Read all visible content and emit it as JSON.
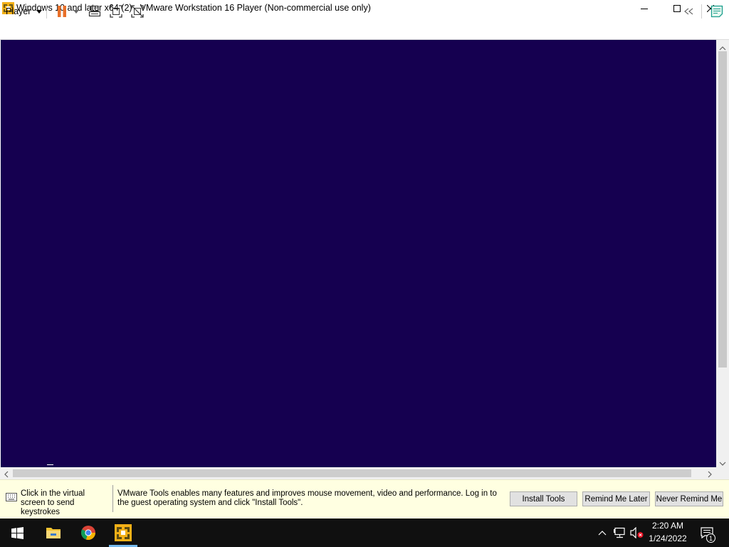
{
  "window": {
    "title": "Windows 10 and later x64 (2) - VMware Workstation 16 Player (Non-commercial use only)",
    "controls": [
      "minimize-icon",
      "maximize-icon",
      "close-icon"
    ]
  },
  "toolbar": {
    "player_menu": "Player",
    "icons": [
      "pause-icon",
      "dropdown-icon",
      "send-ctrl-alt-del-icon",
      "full-screen-icon",
      "unity-icon",
      "collapse-icon",
      "messages-icon"
    ],
    "pause_color": "#e8702a"
  },
  "vm": {
    "screen_color": "#150050"
  },
  "message_bar": {
    "keystroke_hint": "Click in the virtual screen to send keystrokes",
    "tools_message": "VMware Tools enables many features and improves mouse movement, video and performance. Log in to the guest operating system and click \"Install Tools\".",
    "buttons": {
      "install": "Install Tools",
      "remind_later": "Remind Me Later",
      "never_remind": "Never Remind Me"
    }
  },
  "taskbar": {
    "apps": [
      "start-icon",
      "file-explorer-icon",
      "chrome-icon",
      "vmware-player-icon"
    ],
    "active_app": "vmware-player-icon",
    "tray_icons": [
      "chevron-up-icon",
      "network-icon",
      "volume-muted-icon"
    ],
    "clock": {
      "time": "2:20 AM",
      "date": "1/24/2022"
    },
    "notification_count": "1"
  }
}
